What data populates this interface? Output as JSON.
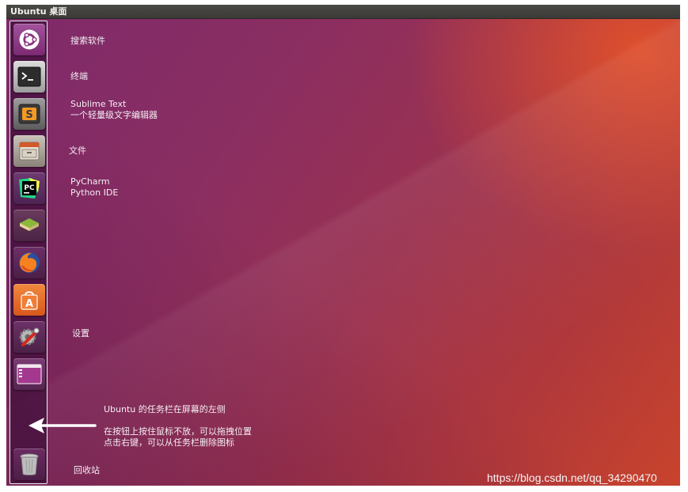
{
  "window": {
    "title": "Ubuntu 桌面"
  },
  "launcher": {
    "items": [
      {
        "icon": "ubuntu-logo-icon",
        "label": "搜索软件"
      },
      {
        "icon": "terminal-icon",
        "label": "终端"
      },
      {
        "icon": "sublime-text-icon",
        "label": "Sublime Text",
        "sublabel": "一个轻量级文字编辑器"
      },
      {
        "icon": "file-manager-icon",
        "label": "文件"
      },
      {
        "icon": "pycharm-icon",
        "label": "PyCharm",
        "sublabel": "Python IDE"
      },
      {
        "icon": "book-stack-icon"
      },
      {
        "icon": "firefox-icon"
      },
      {
        "icon": "software-center-icon"
      },
      {
        "icon": "system-settings-icon",
        "label": "设置"
      },
      {
        "icon": "workspace-switcher-icon"
      },
      {
        "icon": "trash-icon",
        "label": "回收站"
      }
    ]
  },
  "annotation": {
    "title": "Ubuntu 的任务栏在屏幕的左侧",
    "line1": "在按钮上按住鼠标不放，可以拖拽位置",
    "line2": "点击右键，可以从任务栏删除图标"
  },
  "watermark": "https://blog.csdn.net/qq_34290470",
  "colors": {
    "launcher_bg": "#3e0e3a",
    "desktop_purple": "#7e2a6a",
    "desktop_orange": "#c8432c",
    "topbar": "#3b3a36"
  }
}
